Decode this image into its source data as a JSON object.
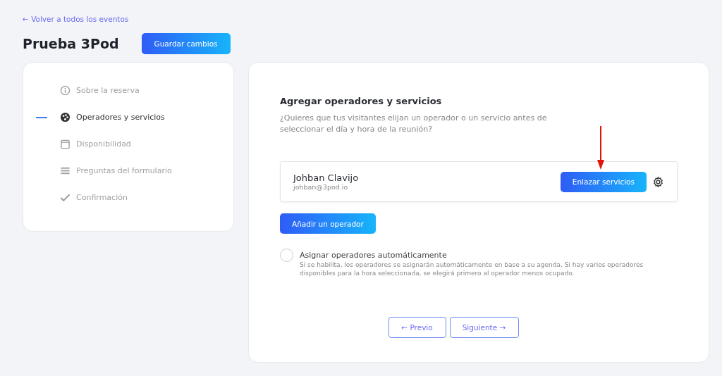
{
  "back_link": "← Volver a todos los eventos",
  "title": "Prueba 3Pod",
  "save_button": "Guardar cambios",
  "sidebar": {
    "items": [
      {
        "label": "Sobre la reserva",
        "kind": "info",
        "selected": false
      },
      {
        "label": "Operadores y servicios",
        "kind": "palette",
        "selected": true
      },
      {
        "label": "Disponibilidad",
        "kind": "calendar",
        "selected": false
      },
      {
        "label": "Preguntas del formulario",
        "kind": "lines",
        "selected": false
      },
      {
        "label": "Confirmación",
        "kind": "check",
        "selected": false
      }
    ]
  },
  "section": {
    "heading": "Agregar operadores y servicios",
    "description": "¿Quieres que tus visitantes elijan un operador o un servicio antes de seleccionar el día y hora de la reunión?"
  },
  "operators": [
    {
      "name": "Johban Clavijo",
      "email": "johban@3pod.io",
      "action": "Enlazar servicios"
    }
  ],
  "add_operator": "Añadir un operador",
  "auto_assign": {
    "label": "Asignar operadores automáticamente",
    "checked": false,
    "help": "Si se habilita, los operadores se asignarán automáticamente en base a su agenda. Si hay varios operadores disponibles para la hora seleccionada, se elegirá primero al operador menos ocupado."
  },
  "footer": {
    "previous": "← Previo",
    "next": "Siguiente →"
  }
}
